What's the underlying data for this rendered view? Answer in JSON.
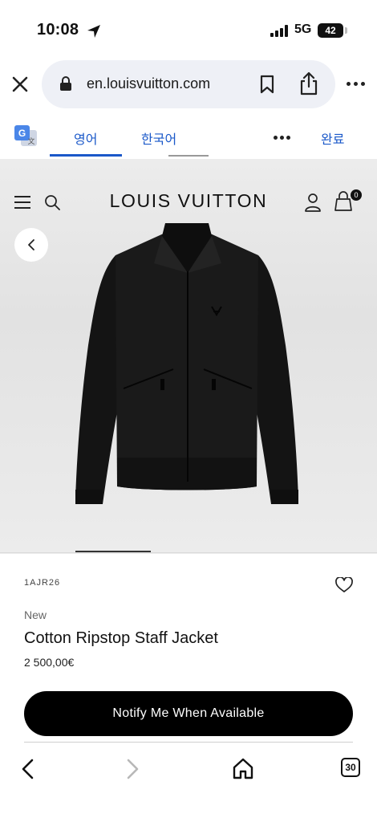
{
  "status_bar": {
    "time": "10:08",
    "network": "5G",
    "battery": "42"
  },
  "browser": {
    "url": "en.louisvuitton.com",
    "tab_count": "30"
  },
  "translate_bar": {
    "tabs": [
      "영어",
      "한국어"
    ],
    "active_tab": "영어",
    "done_label": "완료"
  },
  "site_header": {
    "brand": "LOUIS VUITTON",
    "bag_count": "0"
  },
  "product": {
    "sku": "1AJR26",
    "tag": "New",
    "title": "Cotton Ripstop Staff Jacket",
    "price": "2 500,00€",
    "cta_label": "Notify Me When Available",
    "image_icon": "black-jacket-image"
  },
  "colors": {
    "link_blue": "#1a58c9",
    "cta_black": "#000000",
    "image_bg": "#e5e5e5"
  },
  "icons": [
    "close-icon",
    "lock-icon",
    "bookmark-icon",
    "share-icon",
    "more-icon",
    "google-translate-icon",
    "menu-icon",
    "search-icon",
    "account-icon",
    "bag-icon",
    "chevron-left-icon",
    "heart-icon",
    "back-arrow-icon",
    "forward-arrow-icon",
    "home-icon",
    "tabs-icon"
  ]
}
